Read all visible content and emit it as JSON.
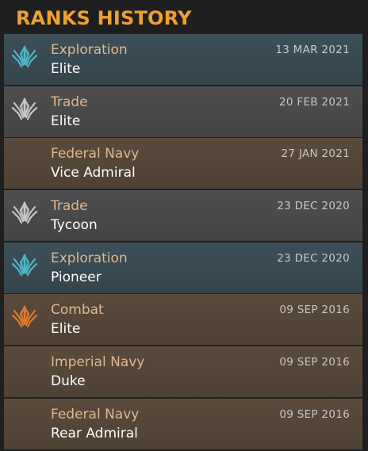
{
  "header": {
    "title": "RANKS HISTORY"
  },
  "ranks": [
    {
      "category": "Exploration",
      "rank": "Elite",
      "date": "13 MAR 2021",
      "kind": "exploration",
      "icon": "exploration-emblem-icon",
      "icon_color": "#4fb8c8"
    },
    {
      "category": "Trade",
      "rank": "Elite",
      "date": "20 FEB 2021",
      "kind": "trade",
      "icon": "trade-emblem-icon",
      "icon_color": "#c8c8c8"
    },
    {
      "category": "Federal Navy",
      "rank": "Vice Admiral",
      "date": "27 JAN 2021",
      "kind": "navy",
      "icon": "",
      "icon_color": ""
    },
    {
      "category": "Trade",
      "rank": "Tycoon",
      "date": "23 DEC 2020",
      "kind": "trade",
      "icon": "trade-emblem-icon",
      "icon_color": "#c8c8c8"
    },
    {
      "category": "Exploration",
      "rank": "Pioneer",
      "date": "23 DEC 2020",
      "kind": "exploration",
      "icon": "exploration-emblem-icon",
      "icon_color": "#4fb8c8"
    },
    {
      "category": "Combat",
      "rank": "Elite",
      "date": "09 SEP 2016",
      "kind": "combat",
      "icon": "combat-emblem-icon",
      "icon_color": "#e07a30"
    },
    {
      "category": "Imperial Navy",
      "rank": "Duke",
      "date": "09 SEP 2016",
      "kind": "navy",
      "icon": "",
      "icon_color": ""
    },
    {
      "category": "Federal Navy",
      "rank": "Rear Admiral",
      "date": "09 SEP 2016",
      "kind": "navy",
      "icon": "",
      "icon_color": ""
    }
  ],
  "colors": {
    "title": "#f0a030",
    "category_text": "#e0b890",
    "rank_text": "#ffffff",
    "date_text": "#c8c8c8"
  }
}
